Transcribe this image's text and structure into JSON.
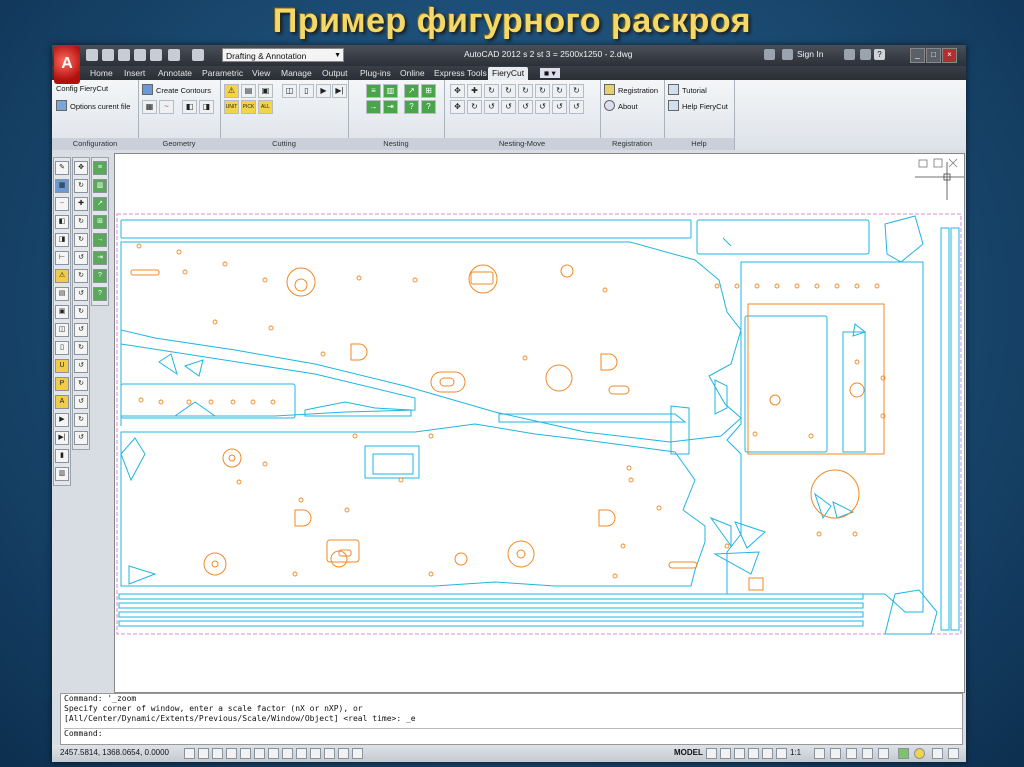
{
  "slide": {
    "title": "Пример фигурного раскроя"
  },
  "app": {
    "title": "AutoCAD 2012   s 2 st 3 = 2500x1250 - 2.dwg",
    "workspace": "Drafting & Annotation",
    "sign_in": "Sign In",
    "help": "?"
  },
  "tabs": [
    "Home",
    "Insert",
    "Annotate",
    "Parametric",
    "View",
    "Manage",
    "Output",
    "Plug-ins",
    "Online",
    "Express Tools",
    "FieryCut"
  ],
  "ribbon": {
    "configuration": {
      "label": "Configuration",
      "config": "Config FieryCut",
      "options": "Options curent file"
    },
    "geometry": {
      "label": "Geometry",
      "create_contours": "Create Contours"
    },
    "cutting": {
      "label": "Cutting",
      "unit": "UNIT",
      "pick": "PICK",
      "all": "ALL"
    },
    "nesting": {
      "label": "Nesting"
    },
    "nesting_move": {
      "label": "Nesting-Move"
    },
    "registration": {
      "label": "Registration",
      "registration": "Registration",
      "about": "About"
    },
    "help": {
      "label": "Help",
      "tutorial": "Tutorial",
      "help_fierycut": "Help FieryCut"
    }
  },
  "command": {
    "line1": "Command: '_zoom",
    "line2": "Specify corner of window, enter a scale factor (nX or nXP), or",
    "line3": "[All/Center/Dynamic/Extents/Previous/Scale/Window/Object] <real time>: _e",
    "prompt": "Command:"
  },
  "status": {
    "coords": "2457.5814, 1368.0654, 0.0000",
    "model": "MODEL",
    "scale": "1:1"
  },
  "colors": {
    "cyan_part": "#1fb5e0",
    "orange_hole": "#f08a24",
    "sheet_border": "#cc66cc"
  }
}
